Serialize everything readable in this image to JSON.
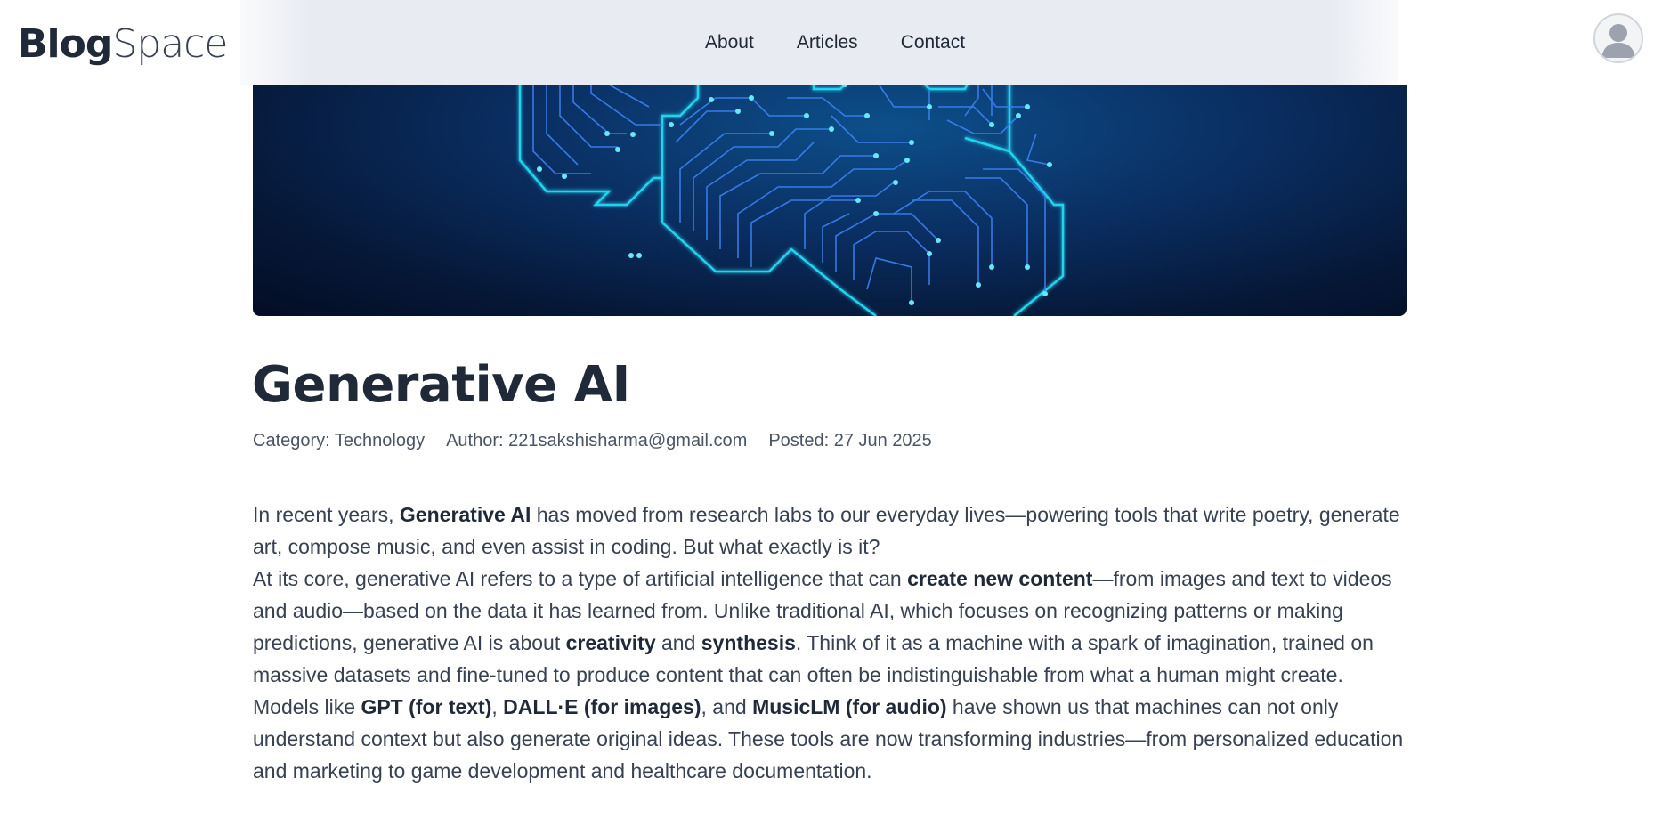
{
  "header": {
    "logo_bold": "Blog",
    "logo_light": "Space",
    "nav": [
      "About",
      "Articles",
      "Contact"
    ]
  },
  "article": {
    "title": "Generative AI",
    "meta": {
      "category": "Category: Technology",
      "author": "Author: 221sakshisharma@gmail.com",
      "posted": "Posted: 27 Jun 2025"
    },
    "paragraphs": [
      [
        {
          "t": "In recent years, "
        },
        {
          "t": "Generative AI",
          "b": true
        },
        {
          "t": " has moved from research labs to our everyday lives—powering tools that write poetry, generate art, compose music, and even assist in coding. But what exactly is it?"
        }
      ],
      [
        {
          "t": "At its core, generative AI refers to a type of artificial intelligence that can "
        },
        {
          "t": "create new content",
          "b": true
        },
        {
          "t": "—from images and text to videos and audio—based on the data it has learned from. Unlike traditional AI, which focuses on recognizing patterns or making predictions, generative AI is about "
        },
        {
          "t": "creativity",
          "b": true
        },
        {
          "t": " and "
        },
        {
          "t": "synthesis",
          "b": true
        },
        {
          "t": ". Think of it as a machine with a spark of imagination, trained on massive datasets and fine-tuned to produce content that can often be indistinguishable from what a human might create."
        }
      ],
      [
        {
          "t": "Models like "
        },
        {
          "t": "GPT (for text)",
          "b": true
        },
        {
          "t": ", "
        },
        {
          "t": "DALL·E (for images)",
          "b": true
        },
        {
          "t": ", and "
        },
        {
          "t": "MusicLM (for audio)",
          "b": true
        },
        {
          "t": " have shown us that machines can not only understand context but also generate original ideas. These tools are now transforming industries—from personalized education and marketing to game development and healthcare documentation."
        }
      ]
    ]
  },
  "icons": {
    "avatar": "user-avatar-icon"
  },
  "colors": {
    "hero_bg": "#061838",
    "circuit": "#22d3ee",
    "text": "#1f2937"
  }
}
